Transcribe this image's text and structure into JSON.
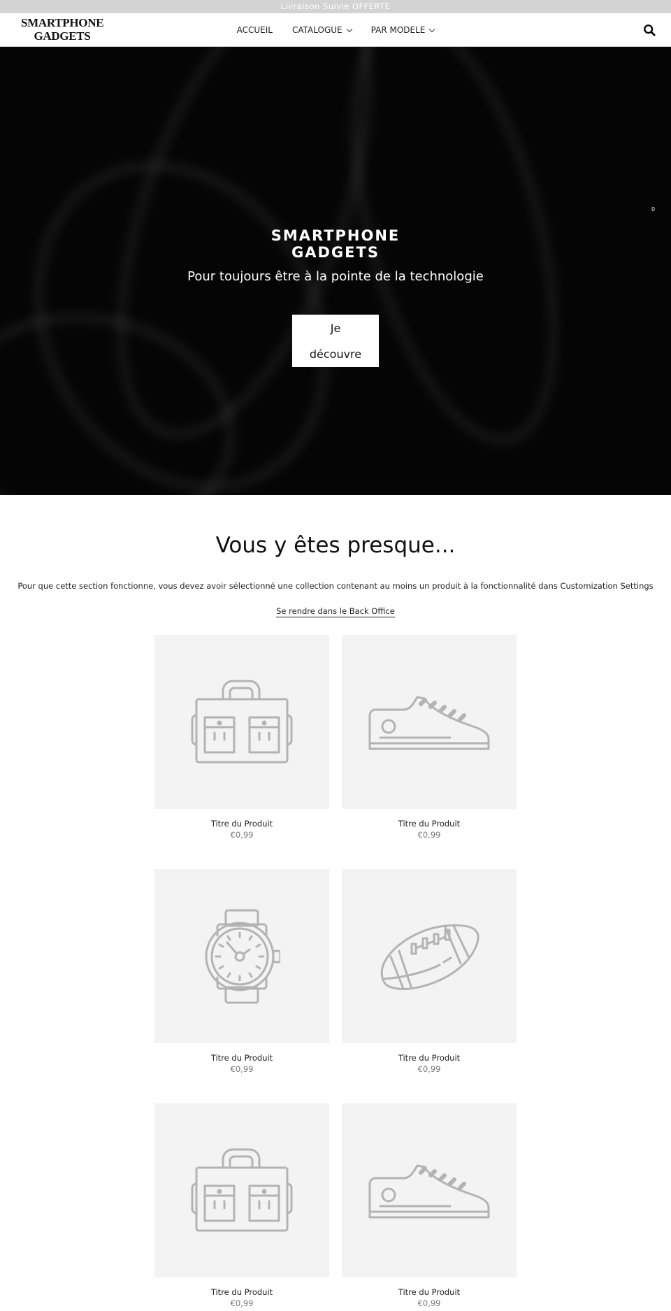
{
  "topbar": {
    "text": "Livraison Suivie OFFERTE"
  },
  "header": {
    "logo": "SMARTPHONE GADGETS",
    "logo_line1": "SMARTPHONE",
    "logo_line2": "GADGETS",
    "nav": [
      {
        "label": "ACCUEIL",
        "dropdown": false
      },
      {
        "label": "CATALOGUE",
        "dropdown": true
      },
      {
        "label": "PAR MODELE",
        "dropdown": true
      }
    ],
    "search_icon": "search-icon"
  },
  "hero": {
    "title_line1": "SMARTPHONE",
    "title_line2": "GADGETS",
    "subtitle": "Pour toujours être à la pointe de la technologie",
    "button_line1": "Je",
    "button_line2": "découvre",
    "cart_count": "0"
  },
  "section": {
    "title": "Vous y êtes presque...",
    "description": "Pour que cette section fonctionne, vous devez avoir sélectionné une collection contenant au moins un produit à la fonctionnalité dans Customization Settings",
    "link": "Se rendre dans le Back Office"
  },
  "products": [
    {
      "title": "Titre du Produit",
      "price": "€0,99",
      "icon": "bag"
    },
    {
      "title": "Titre du Produit",
      "price": "€0,99",
      "icon": "shoe"
    },
    {
      "title": "Titre du Produit",
      "price": "€0,99",
      "icon": "watch"
    },
    {
      "title": "Titre du Produit",
      "price": "€0,99",
      "icon": "football"
    },
    {
      "title": "Titre du Produit",
      "price": "€0,99",
      "icon": "bag"
    },
    {
      "title": "Titre du Produit",
      "price": "€0,99",
      "icon": "shoe"
    }
  ],
  "colors": {
    "topbar": "#d3d3d3",
    "hero_bg": "#050505",
    "placeholder_bg": "#f3f3f3",
    "icon_stroke": "#b3b3b3"
  }
}
